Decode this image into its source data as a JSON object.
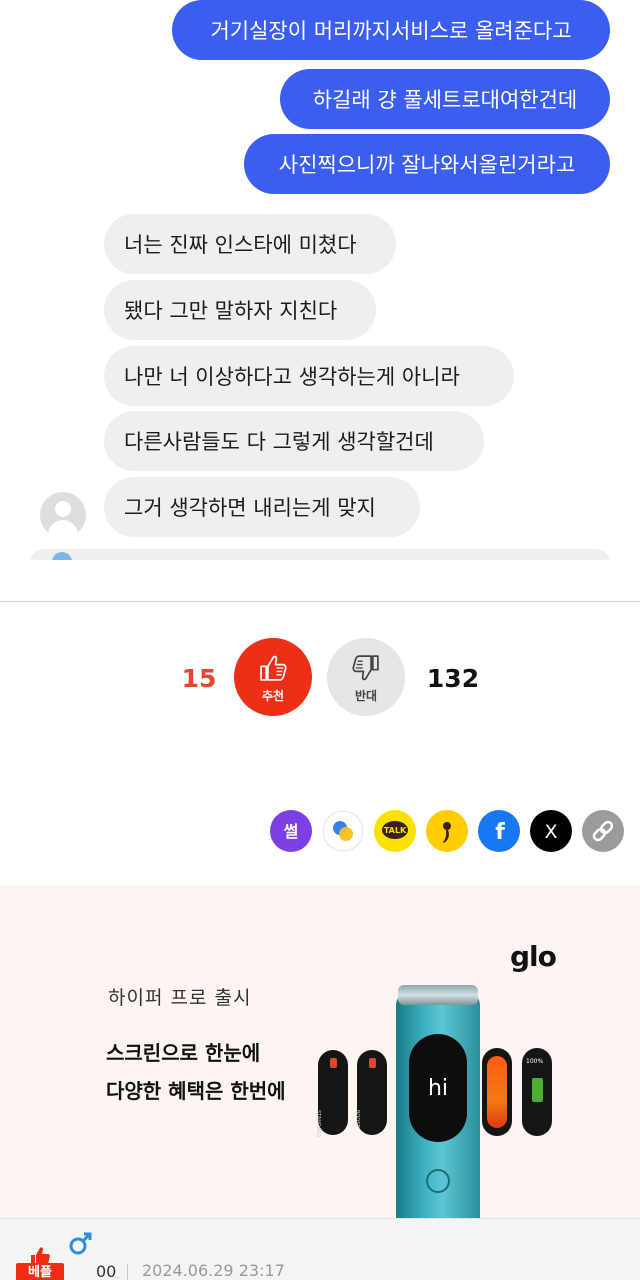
{
  "chat": {
    "sent": [
      "거기실장이 머리까지서비스로 올려준다고",
      "하길래 걍 풀세트로대여한건데",
      "사진찍으니까 잘나와서올린거라고"
    ],
    "received": [
      "너는 진짜 인스타에 미쳤다",
      "됐다 그만 말하자 지친다",
      "나만 너 이상하다고 생각하는게 아니라",
      "다른사람들도 다 그렇게 생각할건데",
      "그거 생각하면 내리는게 맞지"
    ]
  },
  "vote": {
    "up_count": "15",
    "up_label": "추천",
    "down_count": "132",
    "down_label": "반대",
    "up_color": "#ee2f18"
  },
  "share": [
    {
      "name": "seol-icon",
      "label": "썰",
      "color": "#7b3fe4"
    },
    {
      "name": "circle-overlap-icon",
      "label": "",
      "color": "#ffffff"
    },
    {
      "name": "kakaotalk-icon",
      "label": "TALK",
      "color": "#fae100"
    },
    {
      "name": "kakaostory-icon",
      "label": "",
      "color": "#ffcd00"
    },
    {
      "name": "facebook-icon",
      "label": "f",
      "color": "#1877f2"
    },
    {
      "name": "x-icon",
      "label": "X",
      "color": "#000000"
    },
    {
      "name": "link-icon",
      "label": "",
      "color": "#9b9b9b"
    }
  ],
  "ad": {
    "brand": "glo",
    "subtitle": "하이퍼 프로 출시",
    "line1": "스크린으로 한눈에",
    "line2": "다양한 혜택은 한번에",
    "screen_text": "hi",
    "pill_labels": [
      "STANDARD",
      "BOOST",
      "100%"
    ]
  },
  "post_meta": {
    "badge": "베플",
    "username": "00",
    "datetime": "2024.06.29 23:17"
  }
}
